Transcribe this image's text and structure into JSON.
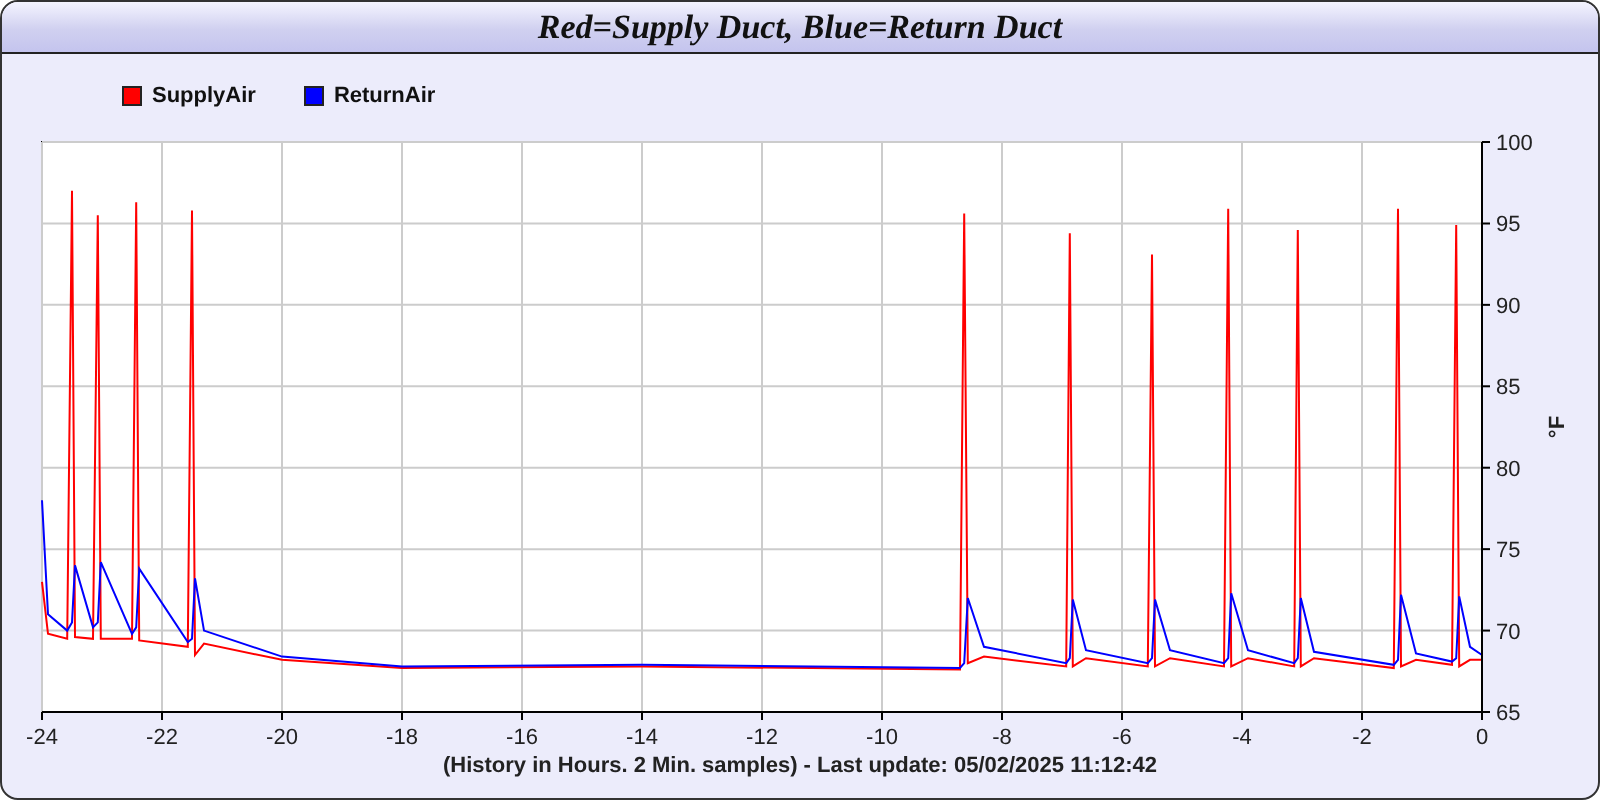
{
  "chart_data": {
    "type": "line",
    "grid": true,
    "title": "Red=Supply Duct, Blue=Return Duct",
    "xlabel": "(History in Hours. 2 Min. samples) - Last update: 05/02/2025 11:12:42",
    "ylabel": "°F",
    "x": [
      -24,
      -23.9,
      -23.58,
      -23.5,
      -23.45,
      -23.15,
      -23.07,
      -23.02,
      -22.5,
      -22.43,
      -22.38,
      -21.57,
      -21.5,
      -21.45,
      -21.3,
      -20,
      -18,
      -14,
      -8.7,
      -8.63,
      -8.57,
      -8.3,
      -6.93,
      -6.87,
      -6.82,
      -6.6,
      -5.57,
      -5.5,
      -5.45,
      -5.2,
      -4.3,
      -4.23,
      -4.18,
      -3.9,
      -3.13,
      -3.07,
      -3.02,
      -2.8,
      -1.47,
      -1.4,
      -1.35,
      -1.1,
      -0.5,
      -0.43,
      -0.38,
      -0.2,
      0
    ],
    "series": [
      {
        "name": "SupplyAir",
        "color": "#ff0000",
        "values": [
          73,
          69.8,
          69.5,
          97,
          69.6,
          69.5,
          95.5,
          69.5,
          69.5,
          96.3,
          69.4,
          69,
          95.8,
          68.5,
          69.2,
          68.2,
          67.7,
          67.8,
          67.6,
          95.6,
          68,
          68.4,
          67.8,
          94.4,
          67.8,
          68.3,
          67.8,
          93.1,
          67.8,
          68.3,
          67.8,
          95.9,
          67.8,
          68.3,
          67.8,
          94.6,
          67.8,
          68.3,
          67.7,
          95.9,
          67.8,
          68.2,
          67.9,
          94.9,
          67.8,
          68.2,
          68.2
        ]
      },
      {
        "name": "ReturnAir",
        "color": "#0000ff",
        "values": [
          78,
          71,
          70,
          70.5,
          74,
          70.2,
          70.5,
          74.2,
          69.8,
          70.2,
          73.8,
          69.3,
          69.5,
          73.2,
          70,
          68.4,
          67.8,
          67.9,
          67.7,
          68,
          72,
          69,
          68,
          68.3,
          71.9,
          68.8,
          68,
          68.3,
          71.9,
          68.8,
          68,
          68.3,
          72.3,
          68.8,
          68,
          68.3,
          72,
          68.7,
          67.9,
          68.2,
          72.2,
          68.6,
          68.1,
          68.3,
          72.1,
          69,
          68.5
        ]
      }
    ],
    "xlim": [
      -24,
      0
    ],
    "ylim": [
      65,
      100
    ],
    "xticks": [
      -24,
      -22,
      -20,
      -18,
      -16,
      -14,
      -12,
      -10,
      -8,
      -6,
      -4,
      -2,
      0
    ],
    "yticks": [
      65,
      70,
      75,
      80,
      85,
      90,
      95,
      100
    ]
  }
}
